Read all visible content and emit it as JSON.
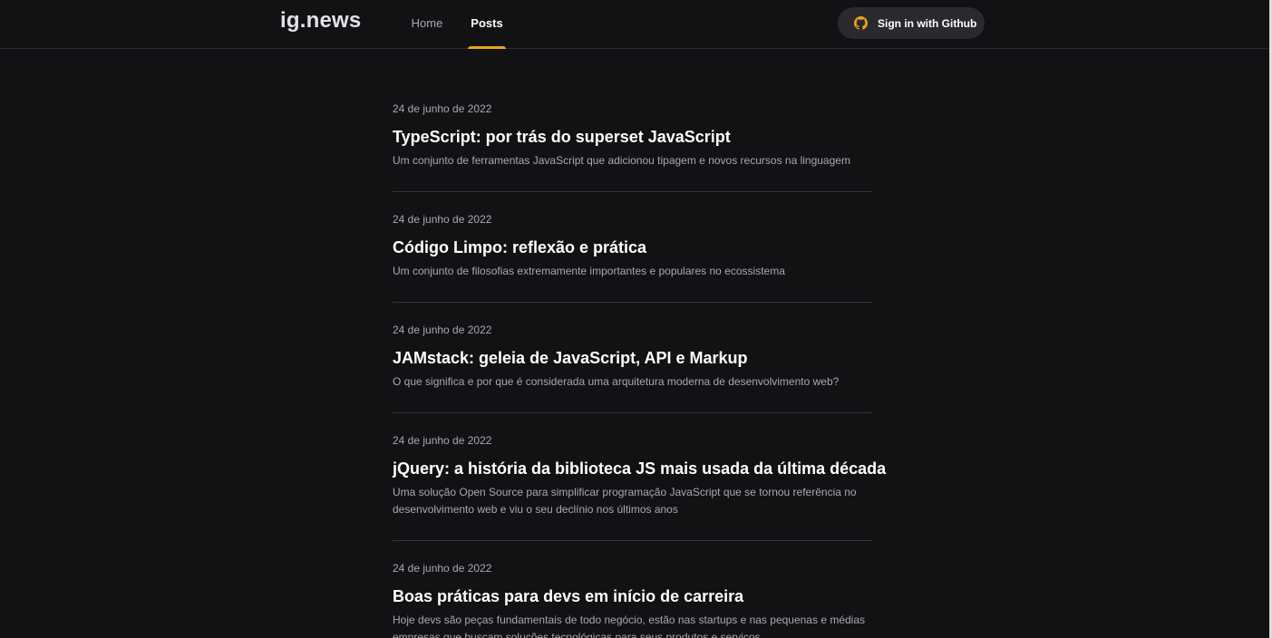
{
  "header": {
    "logo": "ig.news",
    "nav": [
      {
        "label": "Home",
        "active": false
      },
      {
        "label": "Posts",
        "active": true
      }
    ],
    "signin_label": "Sign in with Github",
    "signin_icon": "github-icon",
    "accent_color": "#eba417"
  },
  "posts": [
    {
      "date": "24 de junho de 2022",
      "title": "TypeScript: por trás do superset JavaScript",
      "excerpt": "Um conjunto de ferramentas JavaScript que adicionou tipagem e novos recursos na linguagem"
    },
    {
      "date": "24 de junho de 2022",
      "title": "Código Limpo: reflexão e prática",
      "excerpt": "Um conjunto de filosofias extremamente importantes e populares no ecossistema"
    },
    {
      "date": "24 de junho de 2022",
      "title": "JAMstack: geleia de JavaScript, API e Markup",
      "excerpt": "O que significa e por que é considerada uma arquitetura moderna de desenvolvimento web?"
    },
    {
      "date": "24 de junho de 2022",
      "title": "jQuery: a história da biblioteca JS mais usada da última década",
      "excerpt": "Uma solução Open Source para simplificar programação JavaScript que se tornou referência no desenvolvimento web e viu o seu declínio nos últimos anos"
    },
    {
      "date": "24 de junho de 2022",
      "title": "Boas práticas para devs em início de carreira",
      "excerpt": "Hoje devs são peças fundamentais de todo negócio, estão nas startups e nas pequenas e médias empresas que buscam soluções tecnológicas para seus produtos e serviços"
    }
  ]
}
